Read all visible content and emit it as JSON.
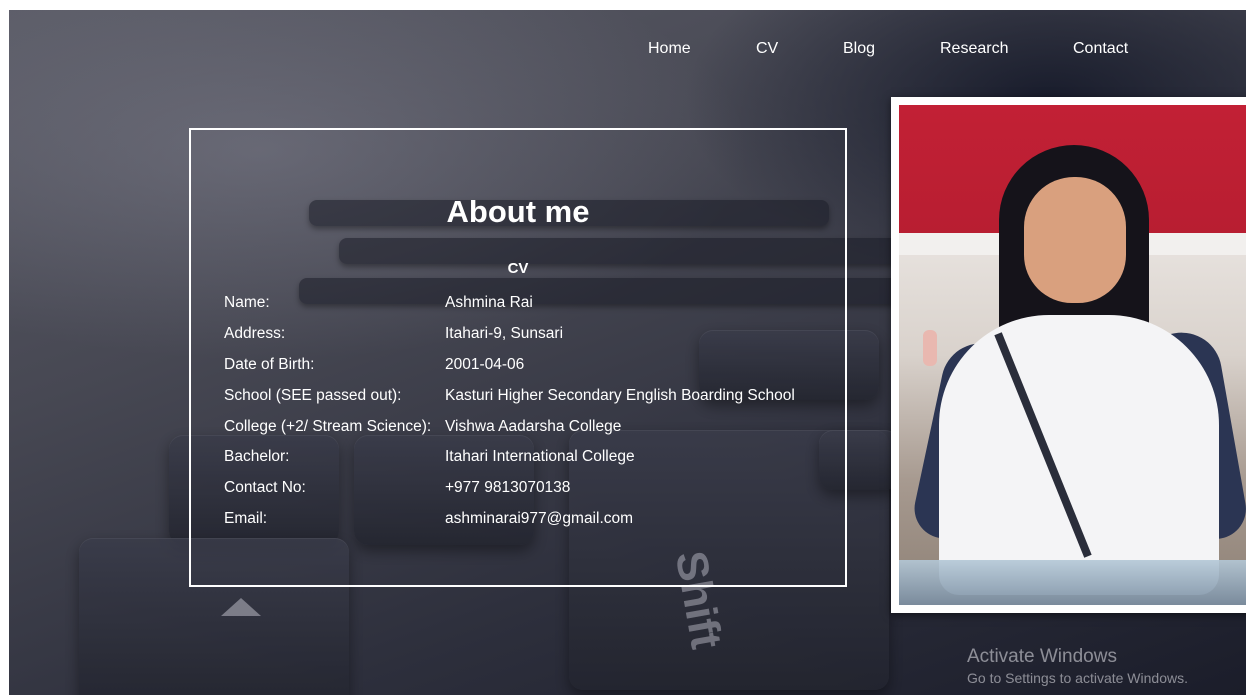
{
  "nav": {
    "items": [
      {
        "label": "Home"
      },
      {
        "label": "CV"
      },
      {
        "label": "Blog"
      },
      {
        "label": "Research"
      },
      {
        "label": "Contact"
      }
    ]
  },
  "about": {
    "title": "About me",
    "cv_heading": "CV",
    "rows": [
      {
        "label": "Name:",
        "value": "Ashmina Rai"
      },
      {
        "label": "Address:",
        "value": "Itahari-9, Sunsari"
      },
      {
        "label": "Date of Birth:",
        "value": "2001-04-06"
      },
      {
        "label": "School (SEE passed out):",
        "value": "Kasturi Higher Secondary English Boarding School"
      },
      {
        "label": "College (+2/ Stream Science):",
        "value": "Vishwa Aadarsha College"
      },
      {
        "label": "Bachelor:",
        "value": "Itahari International College"
      },
      {
        "label": "Contact No:",
        "value": "+977 9813070138"
      },
      {
        "label": "Email:",
        "value": "ashminarai977@gmail.com"
      }
    ]
  },
  "watermark": {
    "title": "Activate Windows",
    "subtitle": "Go to Settings to activate Windows."
  },
  "colors": {
    "text": "#ffffff",
    "border": "#ffffff"
  }
}
